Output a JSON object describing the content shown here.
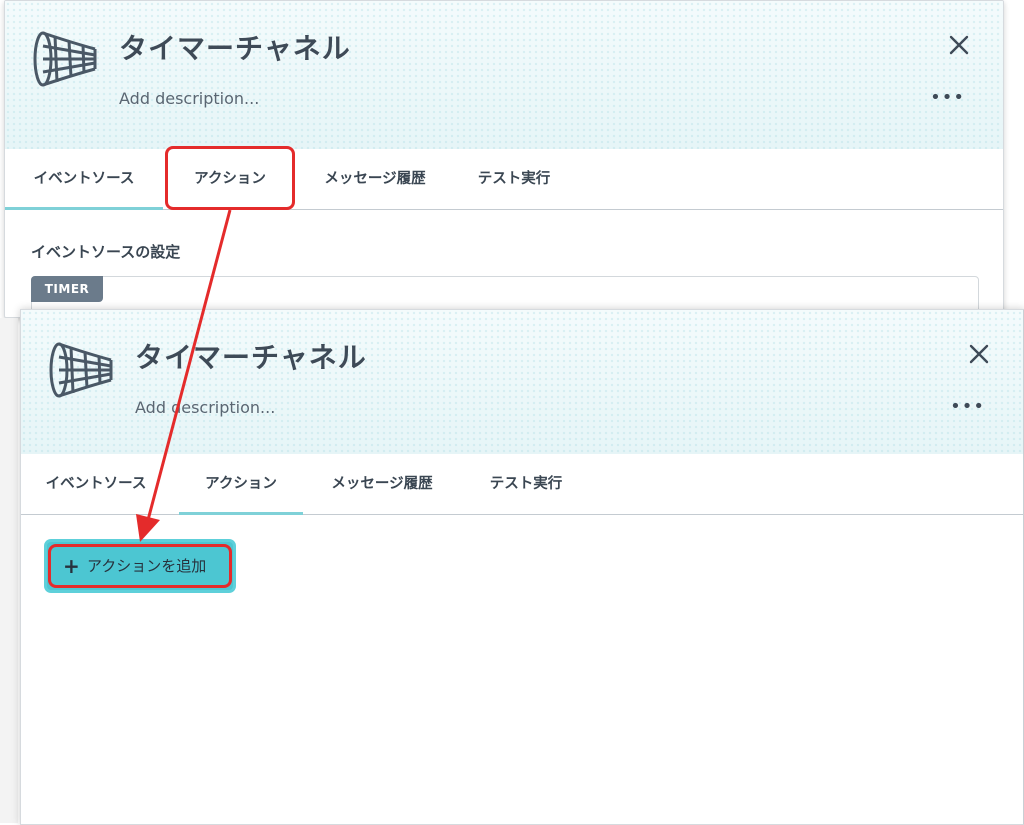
{
  "back_panel": {
    "title": "タイマーチャネル",
    "description": "Add description...",
    "more": "•••",
    "tabs": [
      {
        "label": "イベントソース",
        "active": true
      },
      {
        "label": "アクション",
        "active": false
      },
      {
        "label": "メッセージ履歴",
        "active": false
      },
      {
        "label": "テスト実行",
        "active": false
      }
    ],
    "section_title": "イベントソースの設定",
    "source_badge": "TIMER"
  },
  "front_panel": {
    "title": "タイマーチャネル",
    "description": "Add description...",
    "more": "•••",
    "tabs": [
      {
        "label": "イベントソース",
        "active": false
      },
      {
        "label": "アクション",
        "active": true
      },
      {
        "label": "メッセージ履歴",
        "active": false
      },
      {
        "label": "テスト実行",
        "active": false
      }
    ],
    "add_action_icon": "+",
    "add_action_label": "アクションを追加"
  },
  "icons": {
    "logo": "net-cone-icon",
    "close": "close-icon"
  },
  "colors": {
    "accent": "#4cc6d2",
    "highlight": "#e42b2b",
    "text": "#3a4652",
    "badge": "#6b7b8b"
  }
}
